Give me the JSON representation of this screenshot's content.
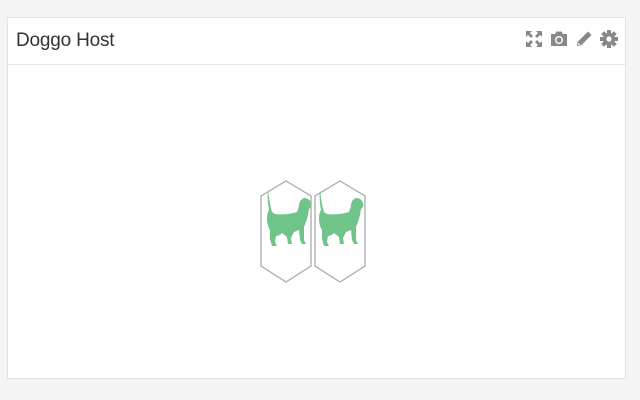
{
  "widget": {
    "title": "Doggo Host",
    "toolbar": [
      {
        "name": "expand-icon"
      },
      {
        "name": "camera-icon"
      },
      {
        "name": "pencil-icon"
      },
      {
        "name": "gear-icon"
      }
    ],
    "icon_color": "#888888",
    "hexagons": [
      {
        "name": "dog-hexagon-1",
        "icon": "dog-icon"
      },
      {
        "name": "dog-hexagon-2",
        "icon": "dog-icon"
      }
    ],
    "hex_fill": "#6fc48a",
    "hex_stroke": "#aaaaaa"
  }
}
